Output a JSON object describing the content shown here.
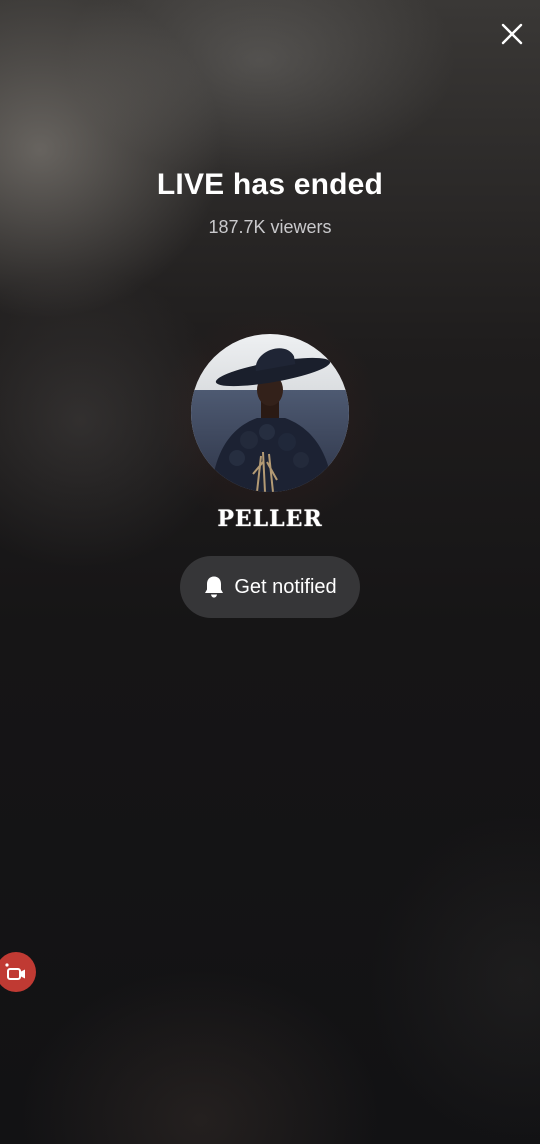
{
  "header": {
    "close_icon": "close-icon"
  },
  "live": {
    "title": "LIVE has ended",
    "viewers_text": "187.7K viewers"
  },
  "host": {
    "username": "PELLER",
    "avatar_icon": "avatar"
  },
  "actions": {
    "notify_label": "Get notified",
    "notify_icon": "bell-icon"
  },
  "floating": {
    "icon": "video-camera-icon"
  },
  "colors": {
    "button_bg": "#363638",
    "floating_button": "#c03a33",
    "background": "#121214"
  }
}
